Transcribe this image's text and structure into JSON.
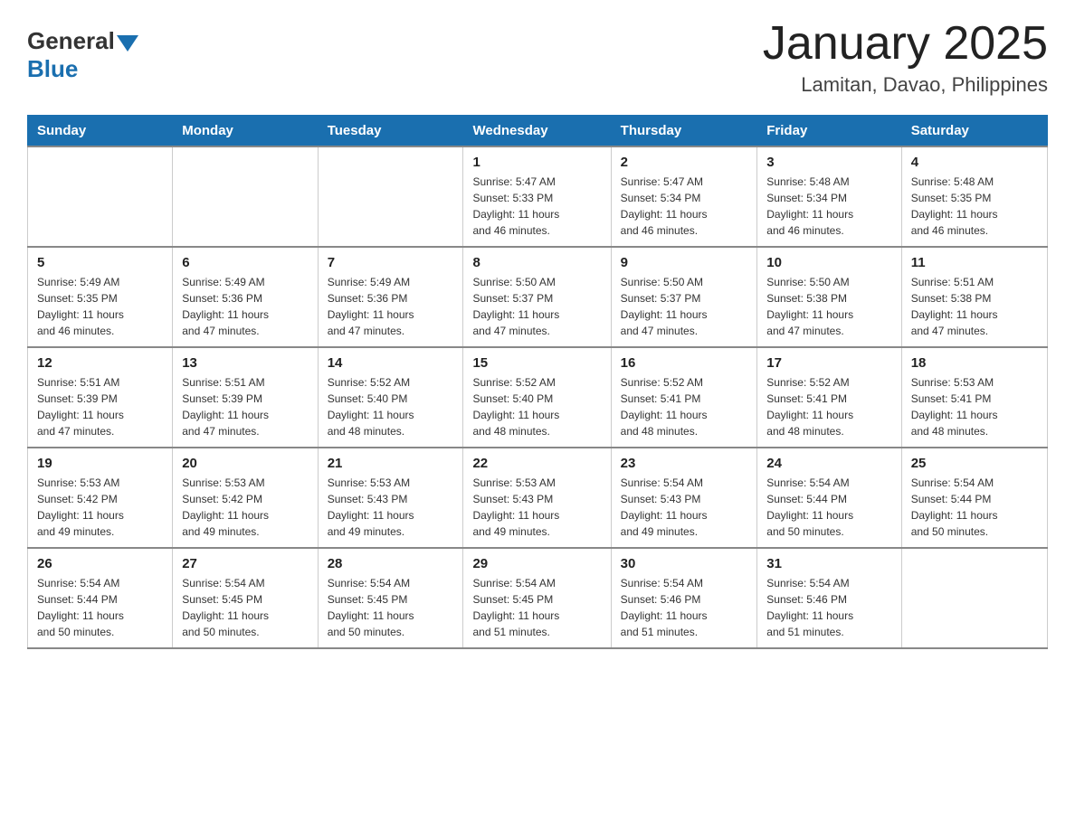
{
  "header": {
    "logo": {
      "general": "General",
      "blue": "Blue"
    },
    "title": "January 2025",
    "location": "Lamitan, Davao, Philippines"
  },
  "calendar": {
    "days": [
      "Sunday",
      "Monday",
      "Tuesday",
      "Wednesday",
      "Thursday",
      "Friday",
      "Saturday"
    ],
    "weeks": [
      [
        {
          "day": "",
          "info": ""
        },
        {
          "day": "",
          "info": ""
        },
        {
          "day": "",
          "info": ""
        },
        {
          "day": "1",
          "info": "Sunrise: 5:47 AM\nSunset: 5:33 PM\nDaylight: 11 hours\nand 46 minutes."
        },
        {
          "day": "2",
          "info": "Sunrise: 5:47 AM\nSunset: 5:34 PM\nDaylight: 11 hours\nand 46 minutes."
        },
        {
          "day": "3",
          "info": "Sunrise: 5:48 AM\nSunset: 5:34 PM\nDaylight: 11 hours\nand 46 minutes."
        },
        {
          "day": "4",
          "info": "Sunrise: 5:48 AM\nSunset: 5:35 PM\nDaylight: 11 hours\nand 46 minutes."
        }
      ],
      [
        {
          "day": "5",
          "info": "Sunrise: 5:49 AM\nSunset: 5:35 PM\nDaylight: 11 hours\nand 46 minutes."
        },
        {
          "day": "6",
          "info": "Sunrise: 5:49 AM\nSunset: 5:36 PM\nDaylight: 11 hours\nand 47 minutes."
        },
        {
          "day": "7",
          "info": "Sunrise: 5:49 AM\nSunset: 5:36 PM\nDaylight: 11 hours\nand 47 minutes."
        },
        {
          "day": "8",
          "info": "Sunrise: 5:50 AM\nSunset: 5:37 PM\nDaylight: 11 hours\nand 47 minutes."
        },
        {
          "day": "9",
          "info": "Sunrise: 5:50 AM\nSunset: 5:37 PM\nDaylight: 11 hours\nand 47 minutes."
        },
        {
          "day": "10",
          "info": "Sunrise: 5:50 AM\nSunset: 5:38 PM\nDaylight: 11 hours\nand 47 minutes."
        },
        {
          "day": "11",
          "info": "Sunrise: 5:51 AM\nSunset: 5:38 PM\nDaylight: 11 hours\nand 47 minutes."
        }
      ],
      [
        {
          "day": "12",
          "info": "Sunrise: 5:51 AM\nSunset: 5:39 PM\nDaylight: 11 hours\nand 47 minutes."
        },
        {
          "day": "13",
          "info": "Sunrise: 5:51 AM\nSunset: 5:39 PM\nDaylight: 11 hours\nand 47 minutes."
        },
        {
          "day": "14",
          "info": "Sunrise: 5:52 AM\nSunset: 5:40 PM\nDaylight: 11 hours\nand 48 minutes."
        },
        {
          "day": "15",
          "info": "Sunrise: 5:52 AM\nSunset: 5:40 PM\nDaylight: 11 hours\nand 48 minutes."
        },
        {
          "day": "16",
          "info": "Sunrise: 5:52 AM\nSunset: 5:41 PM\nDaylight: 11 hours\nand 48 minutes."
        },
        {
          "day": "17",
          "info": "Sunrise: 5:52 AM\nSunset: 5:41 PM\nDaylight: 11 hours\nand 48 minutes."
        },
        {
          "day": "18",
          "info": "Sunrise: 5:53 AM\nSunset: 5:41 PM\nDaylight: 11 hours\nand 48 minutes."
        }
      ],
      [
        {
          "day": "19",
          "info": "Sunrise: 5:53 AM\nSunset: 5:42 PM\nDaylight: 11 hours\nand 49 minutes."
        },
        {
          "day": "20",
          "info": "Sunrise: 5:53 AM\nSunset: 5:42 PM\nDaylight: 11 hours\nand 49 minutes."
        },
        {
          "day": "21",
          "info": "Sunrise: 5:53 AM\nSunset: 5:43 PM\nDaylight: 11 hours\nand 49 minutes."
        },
        {
          "day": "22",
          "info": "Sunrise: 5:53 AM\nSunset: 5:43 PM\nDaylight: 11 hours\nand 49 minutes."
        },
        {
          "day": "23",
          "info": "Sunrise: 5:54 AM\nSunset: 5:43 PM\nDaylight: 11 hours\nand 49 minutes."
        },
        {
          "day": "24",
          "info": "Sunrise: 5:54 AM\nSunset: 5:44 PM\nDaylight: 11 hours\nand 50 minutes."
        },
        {
          "day": "25",
          "info": "Sunrise: 5:54 AM\nSunset: 5:44 PM\nDaylight: 11 hours\nand 50 minutes."
        }
      ],
      [
        {
          "day": "26",
          "info": "Sunrise: 5:54 AM\nSunset: 5:44 PM\nDaylight: 11 hours\nand 50 minutes."
        },
        {
          "day": "27",
          "info": "Sunrise: 5:54 AM\nSunset: 5:45 PM\nDaylight: 11 hours\nand 50 minutes."
        },
        {
          "day": "28",
          "info": "Sunrise: 5:54 AM\nSunset: 5:45 PM\nDaylight: 11 hours\nand 50 minutes."
        },
        {
          "day": "29",
          "info": "Sunrise: 5:54 AM\nSunset: 5:45 PM\nDaylight: 11 hours\nand 51 minutes."
        },
        {
          "day": "30",
          "info": "Sunrise: 5:54 AM\nSunset: 5:46 PM\nDaylight: 11 hours\nand 51 minutes."
        },
        {
          "day": "31",
          "info": "Sunrise: 5:54 AM\nSunset: 5:46 PM\nDaylight: 11 hours\nand 51 minutes."
        },
        {
          "day": "",
          "info": ""
        }
      ]
    ]
  }
}
